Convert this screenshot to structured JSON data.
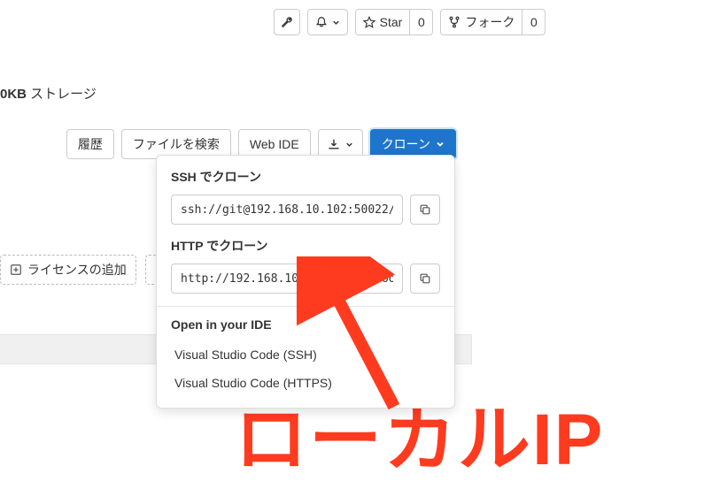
{
  "top": {
    "star_label": "Star",
    "star_count": "0",
    "fork_label": "フォーク",
    "fork_count": "0"
  },
  "storage": {
    "prefix": "0KB",
    "text": " ストレージ"
  },
  "actions": {
    "history": "履歴",
    "find_file": "ファイルを検索",
    "web_ide": "Web IDE",
    "clone": "クローン"
  },
  "clone_dropdown": {
    "ssh_title": "SSH でクローン",
    "ssh_url": "ssh://git@192.168.10.102:50022/",
    "http_title": "HTTP でクローン",
    "http_url": "http://192.168.10.102:50080/roo",
    "ide_title": "Open in your IDE",
    "ide_items": [
      "Visual Studio Code (SSH)",
      "Visual Studio Code (HTTPS)"
    ]
  },
  "add_row": {
    "license": "ライセンスの追加"
  },
  "annotation": {
    "text": "ローカルIP"
  }
}
